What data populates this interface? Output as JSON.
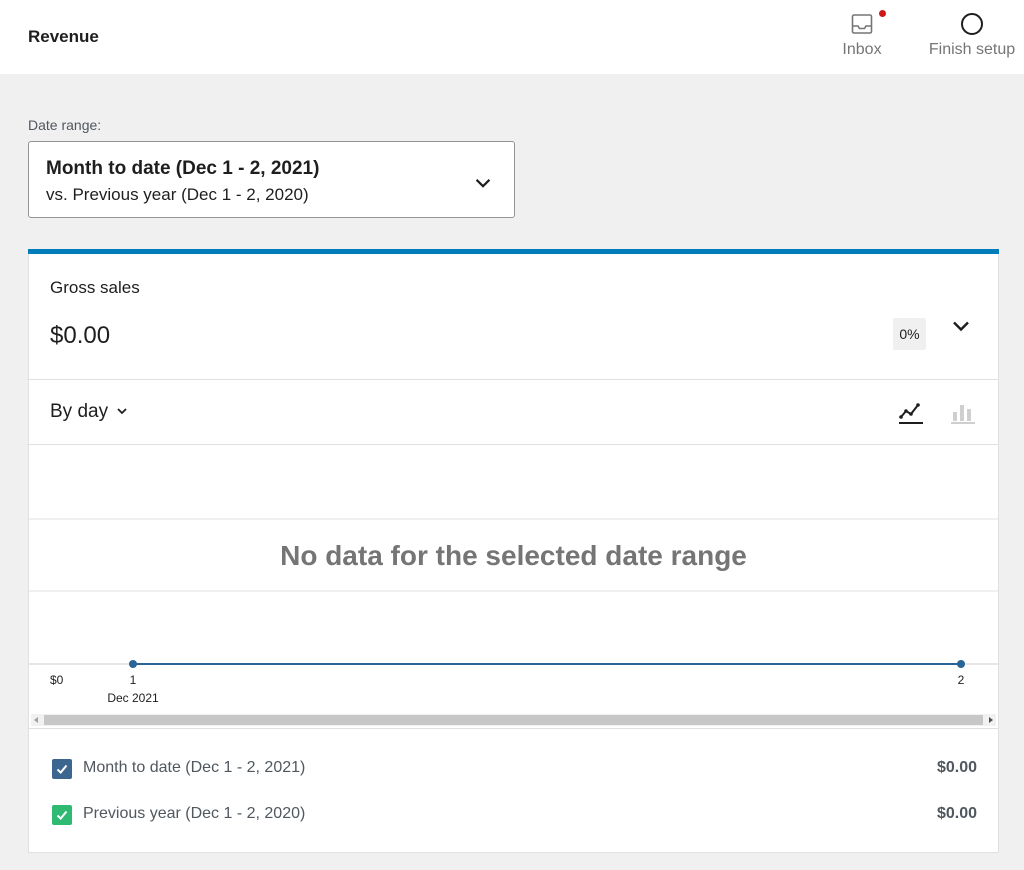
{
  "header": {
    "title": "Revenue",
    "inbox_label": "Inbox",
    "finish_label": "Finish setup"
  },
  "date_range": {
    "label": "Date range:",
    "primary": "Month to date (Dec 1 - 2, 2021)",
    "secondary": "vs. Previous year (Dec 1 - 2, 2020)"
  },
  "metric": {
    "label": "Gross sales",
    "value": "$0.00",
    "delta": "0%"
  },
  "chart_header": {
    "interval": "By day"
  },
  "chart_data": {
    "type": "line",
    "title": "",
    "no_data_message": "No data for the selected date range",
    "y_tick_label": "$0",
    "x_ticks": [
      "1",
      "2"
    ],
    "x_sublabel": "Dec 2021",
    "series": [
      {
        "name": "Month to date (Dec 1 - 2, 2021)",
        "x": [
          "1",
          "2"
        ],
        "values": [
          0,
          0
        ]
      }
    ],
    "colors": {
      "line": "#2a6496",
      "grid": "#e0e0e0",
      "scrollbar": "#c7c7c7"
    }
  },
  "legend": [
    {
      "label": "Month to date (Dec 1 - 2, 2021)",
      "value": "$0.00",
      "color": "#3c6690"
    },
    {
      "label": "Previous year (Dec 1 - 2, 2020)",
      "value": "$0.00",
      "color": "#2eba72"
    }
  ],
  "colors": {
    "accent": "#007cba",
    "notification": "#cc1818"
  }
}
